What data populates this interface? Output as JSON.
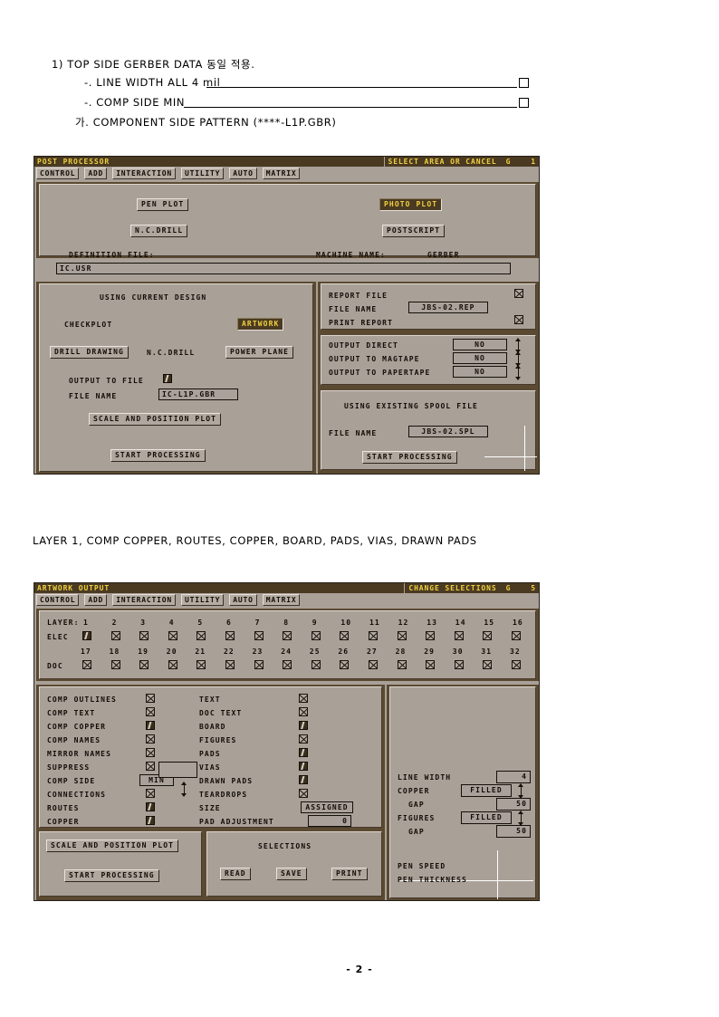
{
  "document": {
    "lines": [
      {
        "text": "1) TOP SIDE GERBER DATA 동일 적용."
      },
      {
        "text": "-. LINE WIDTH ALL 4 mil"
      },
      {
        "text": "-. COMP SIDE MIN"
      },
      {
        "text": "가. COMPONENT SIDE PATTERN (****-L1P.GBR)"
      }
    ],
    "caption": "LAYER 1, COMP COPPER, ROUTES, COPPER, BOARD, PADS, VIAS, DRAWN PADS",
    "page_number": "- 2 -"
  },
  "window1": {
    "title": "POST PROCESSOR",
    "status": "SELECT AREA OR CANCEL",
    "status_g": "G",
    "status_num": "1",
    "menu": [
      "CONTROL",
      "ADD",
      "INTERACTION",
      "UTILITY",
      "AUTO",
      "MATRIX"
    ],
    "top": {
      "pen_plot": "PEN PLOT",
      "photo_plot": "PHOTO PLOT",
      "nc_drill": "N.C.DRILL",
      "postscript": "POSTSCRIPT",
      "definition_file_label": "DEFINITION FILE:",
      "machine_name_label": "MACHINE NAME:",
      "machine_name_value": "GERBER",
      "definition_file_value": "IC.USR"
    },
    "left": {
      "heading": "USING CURRENT DESIGN",
      "checkplot_label": "CHECKPLOT",
      "artwork": "ARTWORK",
      "drill_drawing": "DRILL DRAWING",
      "nc_drill": "N.C.DRILL",
      "power_plane": "POWER PLANE",
      "output_to_file_label": "OUTPUT TO FILE",
      "output_to_file_checked": true,
      "file_name_label": "FILE NAME",
      "file_name_value": "IC-L1P.GBR",
      "scale_and_position": "SCALE AND POSITION PLOT",
      "start_processing": "START PROCESSING"
    },
    "right": {
      "report_file_label": "REPORT FILE",
      "report_file_checked": false,
      "file_name_label": "FILE NAME",
      "file_name_value": "JBS-02.REP",
      "print_report_label": "PRINT REPORT",
      "print_report_checked": false,
      "outputs": [
        {
          "label": "OUTPUT DIRECT",
          "value": "NO"
        },
        {
          "label": "OUTPUT TO MAGTAPE",
          "value": "NO"
        },
        {
          "label": "OUTPUT TO PAPERTAPE",
          "value": "NO"
        }
      ],
      "spool_heading": "USING EXISTING SPOOL FILE",
      "spool_file_name_label": "FILE NAME",
      "spool_file_name_value": "JBS-02.SPL",
      "start_processing": "START PROCESSING"
    }
  },
  "window2": {
    "title": "ARTWORK OUTPUT",
    "status": "CHANGE SELECTIONS",
    "status_g": "G",
    "status_num": "5",
    "menu": [
      "CONTROL",
      "ADD",
      "INTERACTION",
      "UTILITY",
      "AUTO",
      "MATRIX"
    ],
    "layers": {
      "layer_label": "LAYER:",
      "elec_label": "ELEC",
      "doc_label": "DOC",
      "elec_numbers": [
        "1",
        "2",
        "3",
        "4",
        "5",
        "6",
        "7",
        "8",
        "9",
        "10",
        "11",
        "12",
        "13",
        "14",
        "15",
        "16"
      ],
      "elec_checked": [
        true,
        false,
        false,
        false,
        false,
        false,
        false,
        false,
        false,
        false,
        false,
        false,
        false,
        false,
        false,
        false
      ],
      "doc_numbers": [
        "17",
        "18",
        "19",
        "20",
        "21",
        "22",
        "23",
        "24",
        "25",
        "26",
        "27",
        "28",
        "29",
        "30",
        "31",
        "32"
      ],
      "doc_checked": [
        false,
        false,
        false,
        false,
        false,
        false,
        false,
        false,
        false,
        false,
        false,
        false,
        false,
        false,
        false,
        false
      ]
    },
    "options_left": [
      {
        "label": "COMP OUTLINES",
        "checked": false
      },
      {
        "label": "COMP TEXT",
        "checked": false
      },
      {
        "label": "COMP COPPER",
        "checked": true
      },
      {
        "label": "COMP NAMES",
        "checked": false
      },
      {
        "label": "MIRROR NAMES",
        "checked": false
      },
      {
        "label": "SUPPRESS",
        "checked": false
      },
      {
        "label": "COMP SIDE",
        "checked": null,
        "value": "MIN"
      },
      {
        "label": "CONNECTIONS",
        "checked": false
      },
      {
        "label": "ROUTES",
        "checked": true
      },
      {
        "label": "COPPER",
        "checked": true
      }
    ],
    "options_mid": [
      {
        "label": "TEXT",
        "checked": false
      },
      {
        "label": "DOC TEXT",
        "checked": false
      },
      {
        "label": "BOARD",
        "checked": true
      },
      {
        "label": "FIGURES",
        "checked": false
      },
      {
        "label": "PADS",
        "checked": true
      },
      {
        "label": "VIAS",
        "checked": true
      },
      {
        "label": "DRAWN PADS",
        "checked": true
      },
      {
        "label": "TEARDROPS",
        "checked": false
      },
      {
        "label": "SIZE",
        "checked": null,
        "value": "ASSIGNED"
      },
      {
        "label": "PAD ADJUSTMENT",
        "checked": null,
        "value": "0"
      }
    ],
    "right": [
      {
        "label": "LINE WIDTH",
        "value": "4",
        "style": "num"
      },
      {
        "label": "COPPER",
        "value": "FILLED",
        "style": "sel"
      },
      {
        "label": "GAP",
        "value": "50",
        "style": "num"
      },
      {
        "label": "FIGURES",
        "value": "FILLED",
        "style": "sel"
      },
      {
        "label": "GAP",
        "value": "50",
        "style": "num"
      },
      {
        "label": "PEN SPEED",
        "value": "",
        "style": "none"
      },
      {
        "label": "PEN THICKNESS",
        "value": "",
        "style": "none"
      }
    ],
    "bottom": {
      "scale_and_position": "SCALE AND POSITION PLOT",
      "start_processing": "START PROCESSING",
      "selections_heading": "SELECTIONS",
      "read": "READ",
      "save": "SAVE",
      "print": "PRINT"
    }
  }
}
